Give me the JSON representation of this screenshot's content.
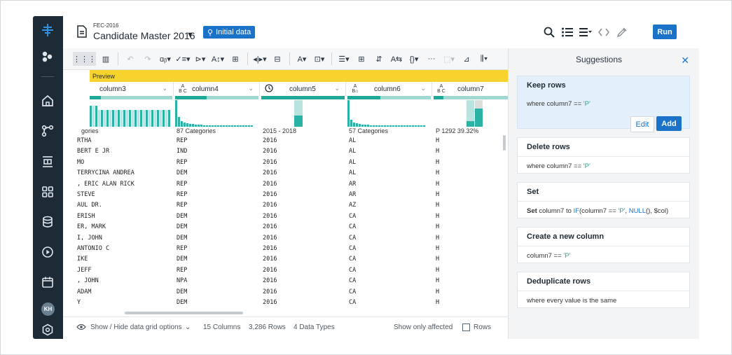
{
  "rail": {
    "avatar_initials": "KH"
  },
  "header": {
    "subtitle": "FEC-2016",
    "title": "Candidate Master 2016",
    "badge": "Initial data",
    "run_label": "Run"
  },
  "grid": {
    "preview_label": "Preview",
    "columns": [
      {
        "name": "column3",
        "type": "",
        "summary": "gories"
      },
      {
        "name": "column4",
        "type": "ABC",
        "summary": "87 Categories"
      },
      {
        "name": "column5",
        "type": "clock",
        "summary": "2015 - 2018"
      },
      {
        "name": "column6",
        "type": "ABC",
        "summary": "57 Categories"
      },
      {
        "name": "column7",
        "type": "ABC",
        "summary": "P  1292  39.32%"
      }
    ],
    "rows": [
      [
        "RTHA",
        "REP",
        "2016",
        "AL",
        "H"
      ],
      [
        "BERT E JR",
        "IND",
        "2016",
        "AL",
        "H"
      ],
      [
        "MO",
        "REP",
        "2016",
        "AL",
        "H"
      ],
      [
        "TERRYCINA ANDREA",
        "DEM",
        "2016",
        "AL",
        "H"
      ],
      [
        ", ERIC ALAN RICK",
        "REP",
        "2016",
        "AR",
        "H"
      ],
      [
        "STEVE",
        "REP",
        "2016",
        "AR",
        "H"
      ],
      [
        "AUL DR.",
        "REP",
        "2016",
        "AZ",
        "H"
      ],
      [
        "ERISH",
        "DEM",
        "2016",
        "CA",
        "H"
      ],
      [
        "ER, MARK",
        "DEM",
        "2016",
        "CA",
        "H"
      ],
      [
        "I, JOHN",
        "DEM",
        "2016",
        "CA",
        "H"
      ],
      [
        "ANTONIO C",
        "REP",
        "2016",
        "CA",
        "H"
      ],
      [
        "IKE",
        "DEM",
        "2016",
        "CA",
        "H"
      ],
      [
        "JEFF",
        "REP",
        "2016",
        "CA",
        "H"
      ],
      [
        ", JOHN",
        "NPA",
        "2016",
        "CA",
        "H"
      ],
      [
        "ADAM",
        "DEM",
        "2016",
        "CA",
        "H"
      ],
      [
        "Y",
        "DEM",
        "2016",
        "CA",
        "H"
      ]
    ]
  },
  "footer": {
    "grid_options": "Show / Hide data grid options",
    "columns_count": "15 Columns",
    "rows_count": "3,286 Rows",
    "data_types": "4 Data Types",
    "show_affected": "Show only affected",
    "rows_label": "Rows"
  },
  "panel": {
    "title": "Suggestions",
    "cards": [
      {
        "title": "Keep rows",
        "body_prefix": "where column7 == ",
        "body_value": "'P'",
        "edit": "Edit",
        "add": "Add"
      },
      {
        "title": "Delete rows",
        "body_prefix": "where column7 == ",
        "body_value": "'P'"
      },
      {
        "title": "Set",
        "b1": "Set",
        "b2": " column7 to ",
        "b3": "IF",
        "b4": "(column7 == ",
        "b5": "'P'",
        "b6": ", ",
        "b7": "NULL",
        "b8": "(), $col)"
      },
      {
        "title": "Create a new column",
        "body_prefix": "column7 == ",
        "body_value": "'P'"
      },
      {
        "title": "Deduplicate rows",
        "body": "where every value is the same"
      }
    ]
  },
  "colors": {
    "accent": "#1b73c9",
    "teal": "#1ea89a",
    "preview": "#f6d32d",
    "rail": "#1d2b36"
  }
}
